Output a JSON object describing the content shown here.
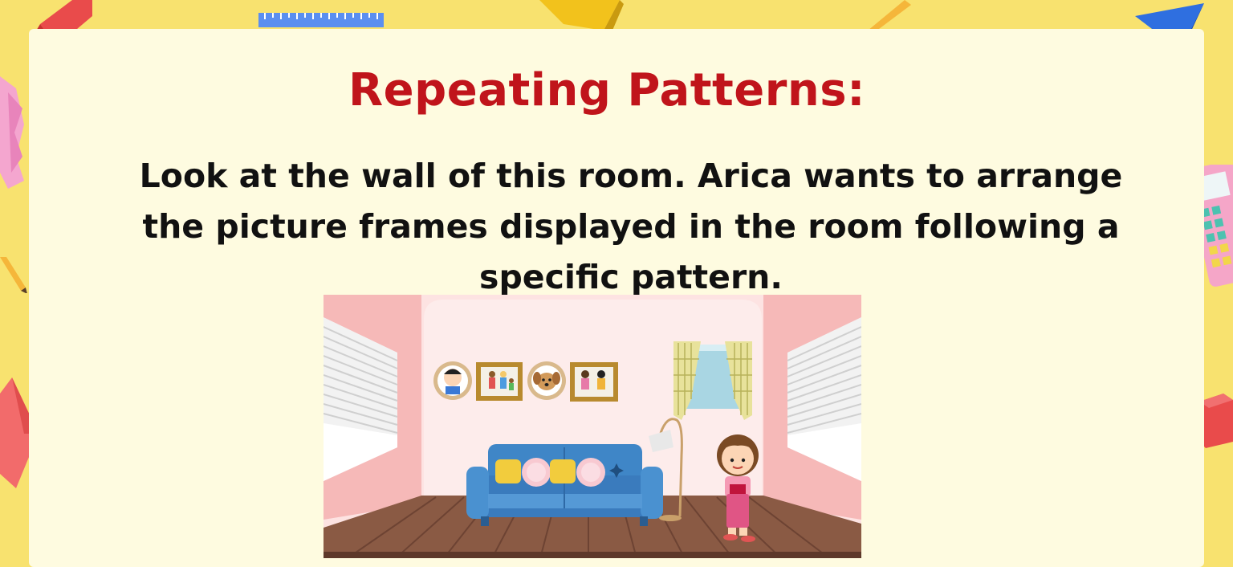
{
  "slide": {
    "title": "Repeating Patterns:",
    "text": "Look at the wall of this room. Arica wants to arrange the picture frames displayed in the room following a specific pattern."
  },
  "colors": {
    "background": "#f8e26f",
    "panel": "#fefbe0",
    "title": "#c0141b",
    "text": "#111111",
    "wall": "#fde3e2",
    "side_wall": "#f6b9b8",
    "floor": "#8a5a44",
    "sofa": "#3f86c7"
  },
  "scene": {
    "wall_frames": [
      "boy-round-frame",
      "family-square-frame",
      "puppy-round-frame",
      "kids-square-frame"
    ],
    "objects": [
      "blinds-left",
      "blinds-right",
      "window-with-curtains",
      "blue-sofa",
      "pillows",
      "floor-lamp",
      "girl",
      "wooden-floor"
    ]
  },
  "decorations": [
    "ruler-icon",
    "pencil-icon",
    "triangle-icon",
    "cube-icon",
    "calculator-icon",
    "gem-icon"
  ]
}
